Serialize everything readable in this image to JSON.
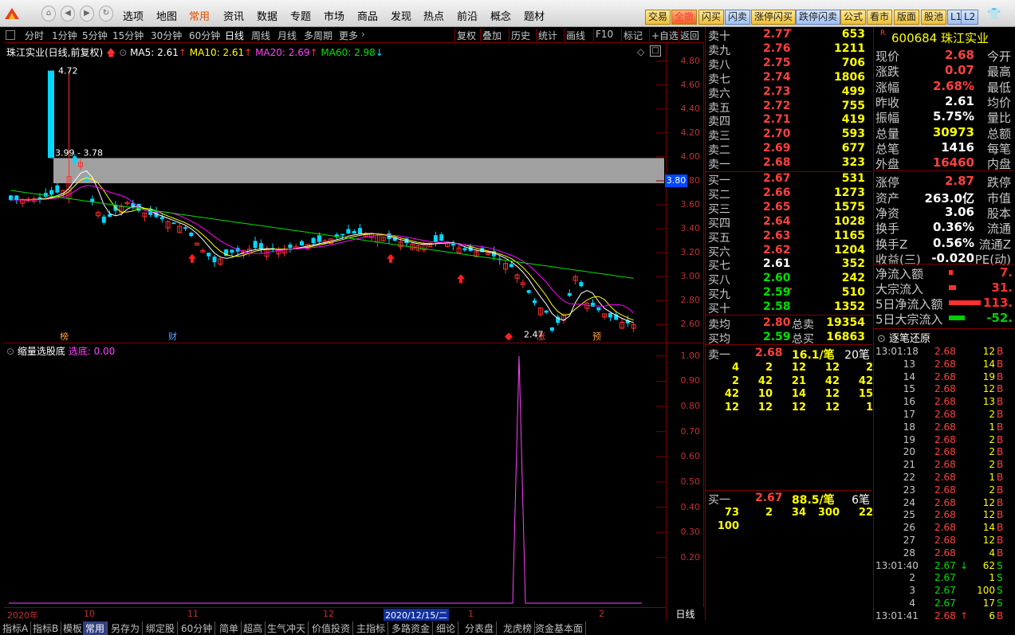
{
  "menu": {
    "items": [
      "选项",
      "地图",
      "常用",
      "资讯",
      "数据",
      "专题",
      "市场",
      "商品",
      "发现",
      "热点",
      "前沿",
      "概念",
      "题材"
    ],
    "active": 2
  },
  "toolbar": {
    "buttons": [
      "交易",
      "全撤",
      "闪买",
      "闪卖",
      "涨停闪买",
      "跌停闪卖",
      "公式",
      "看市",
      "版面",
      "股池",
      "L1",
      "L2"
    ]
  },
  "chartbar": {
    "periods": [
      "分时",
      "1分钟",
      "5分钟",
      "15分钟",
      "30分钟",
      "60分钟",
      "日线",
      "周线",
      "月线",
      "多周期",
      "更多"
    ],
    "active_period": "日线",
    "tools": [
      "复权",
      "叠加",
      "历史",
      "统计",
      "画线",
      "F10",
      "标记",
      "+自选",
      "返回"
    ]
  },
  "chart_header": {
    "title": "珠江实业(日线,前复权)",
    "ma5_label": "MA5: 2.61",
    "ma10_label": "MA10: 2.61",
    "ma20_label": "MA20: 2.69",
    "ma60_label": "MA60: 2.98"
  },
  "chart_data": [
    {
      "type": "candlestick",
      "title": "珠江实业(日线,前复权)",
      "ylim": [
        2.45,
        4.95
      ],
      "y_ticks": [
        "4.80",
        "4.60",
        "4.40",
        "4.20",
        "4.00",
        "3.80",
        "3.60",
        "3.40",
        "3.20",
        "3.00",
        "2.80",
        "2.60"
      ],
      "current_price_label": "3.80",
      "annotations": {
        "high": "4.72",
        "gap_band": "3.99 - 3.78",
        "low": "2.47"
      },
      "event_markers": [
        "榜",
        "财",
        "涨",
        "预"
      ],
      "ma_series": [
        {
          "name": "MA5",
          "color": "#ffffff"
        },
        {
          "name": "MA10",
          "color": "#ffff00"
        },
        {
          "name": "MA20",
          "color": "#ff00ff"
        },
        {
          "name": "MA60",
          "color": "#00e000"
        }
      ],
      "date_labels": [
        "2020年",
        "10",
        "11",
        "12",
        "2020/12/15/二",
        "1",
        "2"
      ]
    },
    {
      "type": "line",
      "title": "缩量选股底",
      "series": [
        {
          "name": "选底",
          "value_label": "选底: 0.00"
        }
      ],
      "ylim": [
        0,
        1.05
      ],
      "y_ticks": [
        "1.00",
        "0.90",
        "0.80",
        "0.70",
        "0.60",
        "0.50",
        "0.40",
        "0.30",
        "0.20"
      ],
      "spike_value": 1.0
    }
  ],
  "indicator": {
    "title": "缩量选股底",
    "value": "选底: 0.00"
  },
  "period_label": "日线",
  "bottom_tabs": [
    "指标A",
    "指标B",
    "模板",
    "常用",
    "另存为",
    "绑定股",
    "60分钟",
    "简单",
    "超高",
    "生气冲天",
    "价值投资",
    "主指标",
    "多路资金",
    "细论",
    "分表盘",
    "龙虎榜",
    "资金基本面"
  ],
  "bottom_active": "常用",
  "ladder": {
    "asks": [
      {
        "label": "卖十",
        "price": "2.77",
        "vol": "653"
      },
      {
        "label": "卖九",
        "price": "2.76",
        "vol": "1211"
      },
      {
        "label": "卖八",
        "price": "2.75",
        "vol": "706"
      },
      {
        "label": "卖七",
        "price": "2.74",
        "vol": "1806"
      },
      {
        "label": "卖六",
        "price": "2.73",
        "vol": "499"
      },
      {
        "label": "卖五",
        "price": "2.72",
        "vol": "755"
      },
      {
        "label": "卖四",
        "price": "2.71",
        "vol": "419"
      },
      {
        "label": "卖三",
        "price": "2.70",
        "vol": "593"
      },
      {
        "label": "卖二",
        "price": "2.69",
        "vol": "677"
      },
      {
        "label": "卖一",
        "price": "2.68",
        "vol": "323"
      }
    ],
    "bids": [
      {
        "label": "买一",
        "price": "2.67",
        "vol": "531"
      },
      {
        "label": "买二",
        "price": "2.66",
        "vol": "1273"
      },
      {
        "label": "买三",
        "price": "2.65",
        "vol": "1575"
      },
      {
        "label": "买四",
        "price": "2.64",
        "vol": "1028"
      },
      {
        "label": "买五",
        "price": "2.63",
        "vol": "1165"
      },
      {
        "label": "买六",
        "price": "2.62",
        "vol": "1204"
      },
      {
        "label": "买七",
        "price": "2.61",
        "vol": "352"
      },
      {
        "label": "买八",
        "price": "2.60",
        "vol": "242"
      },
      {
        "label": "买九",
        "price": "2.59",
        "vol": "510"
      },
      {
        "label": "买十",
        "price": "2.58",
        "vol": "1352"
      }
    ],
    "avg_sell": {
      "label": "卖均",
      "price": "2.80",
      "tlabel": "总卖",
      "total": "19354"
    },
    "avg_buy": {
      "label": "买均",
      "price": "2.59",
      "tlabel": "总买",
      "total": "16863"
    }
  },
  "book": {
    "ask_head": {
      "label": "卖一",
      "price": "2.68",
      "avg": "16.1/笔",
      "count": "20笔"
    },
    "ask_rows": [
      [
        "4",
        "2",
        "12",
        "12",
        "2"
      ],
      [
        "2",
        "42",
        "21",
        "42",
        "42"
      ],
      [
        "42",
        "10",
        "14",
        "12",
        "15"
      ],
      [
        "12",
        "12",
        "12",
        "12",
        "1"
      ]
    ],
    "bid_head": {
      "label": "买一",
      "price": "2.67",
      "avg": "88.5/笔",
      "count": "6笔"
    },
    "bid_rows": [
      [
        "73",
        "2",
        "34",
        "300",
        "22"
      ],
      [
        "100"
      ]
    ]
  },
  "quote": {
    "code": "600684",
    "name": "珠江实业",
    "rows": [
      {
        "l": "现价",
        "v": "2.68",
        "l2": "今开",
        "c": "red"
      },
      {
        "l": "涨跌",
        "v": "0.07",
        "l2": "最高",
        "c": "red"
      },
      {
        "l": "涨幅",
        "v": "2.68%",
        "l2": "最低",
        "c": "red"
      },
      {
        "l": "昨收",
        "v": "2.61",
        "l2": "均价",
        "c": "wht"
      },
      {
        "l": "振幅",
        "v": "5.75%",
        "l2": "量比",
        "c": "wht"
      },
      {
        "l": "总量",
        "v": "30973",
        "l2": "总额",
        "c": "yel"
      },
      {
        "l": "总笔",
        "v": "1416",
        "l2": "每笔",
        "c": "wht"
      },
      {
        "l": "外盘",
        "v": "16460",
        "l2": "内盘",
        "c": "red"
      },
      {
        "l": "涨停",
        "v": "2.87",
        "l2": "跌停",
        "c": "red"
      },
      {
        "l": "资产",
        "v": "263.0亿",
        "l2": "市值",
        "c": "wht"
      },
      {
        "l": "净资",
        "v": "3.06",
        "l2": "股本",
        "c": "wht"
      },
      {
        "l": "换手",
        "v": "0.36%",
        "l2": "流通",
        "c": "wht"
      },
      {
        "l": "换手Z",
        "v": "0.56%",
        "l2": "流通Z",
        "c": "wht"
      },
      {
        "l": "收益(三)",
        "v": "-0.020",
        "l2": "PE(动)",
        "c": "wht"
      }
    ],
    "flows": [
      {
        "l": "净流入额",
        "v": "7.",
        "color": "#ff3030",
        "bar": 0.02
      },
      {
        "l": "大宗流入",
        "v": "31.",
        "color": "#ff3030",
        "bar": 0.12
      },
      {
        "l": "5日净流入额",
        "v": "113.",
        "color": "#ff3030",
        "bar": 0.9
      },
      {
        "l": "5日大宗流入",
        "v": "-52.",
        "color": "#00d000",
        "bar": 0.4
      }
    ]
  },
  "ticks": {
    "title": "逐笔还原",
    "rows": [
      {
        "t": "13:01:18",
        "p": "2.68",
        "v": "12",
        "s": "B"
      },
      {
        "t": "13",
        "p": "2.68",
        "v": "14",
        "s": "B"
      },
      {
        "t": "14",
        "p": "2.68",
        "v": "19",
        "s": "B"
      },
      {
        "t": "15",
        "p": "2.68",
        "v": "12",
        "s": "B"
      },
      {
        "t": "16",
        "p": "2.68",
        "v": "13",
        "s": "B"
      },
      {
        "t": "17",
        "p": "2.68",
        "v": "2",
        "s": "B"
      },
      {
        "t": "18",
        "p": "2.68",
        "v": "1",
        "s": "B"
      },
      {
        "t": "19",
        "p": "2.68",
        "v": "2",
        "s": "B"
      },
      {
        "t": "20",
        "p": "2.68",
        "v": "2",
        "s": "B"
      },
      {
        "t": "21",
        "p": "2.68",
        "v": "2",
        "s": "B"
      },
      {
        "t": "22",
        "p": "2.68",
        "v": "1",
        "s": "B"
      },
      {
        "t": "23",
        "p": "2.68",
        "v": "2",
        "s": "B"
      },
      {
        "t": "24",
        "p": "2.68",
        "v": "12",
        "s": "B"
      },
      {
        "t": "25",
        "p": "2.68",
        "v": "12",
        "s": "B"
      },
      {
        "t": "26",
        "p": "2.68",
        "v": "14",
        "s": "B"
      },
      {
        "t": "27",
        "p": "2.68",
        "v": "12",
        "s": "B"
      },
      {
        "t": "28",
        "p": "2.68",
        "v": "4",
        "s": "B"
      },
      {
        "t": "13:01:40",
        "p": "2.67",
        "v": "62",
        "s": "S",
        "arrow": "down"
      },
      {
        "t": "2",
        "p": "2.67",
        "v": "1",
        "s": "S"
      },
      {
        "t": "3",
        "p": "2.67",
        "v": "100",
        "s": "S"
      },
      {
        "t": "4",
        "p": "2.67",
        "v": "17",
        "s": "S"
      },
      {
        "t": "13:01:41",
        "p": "2.68",
        "v": "6",
        "s": "B",
        "arrow": "up"
      }
    ]
  }
}
